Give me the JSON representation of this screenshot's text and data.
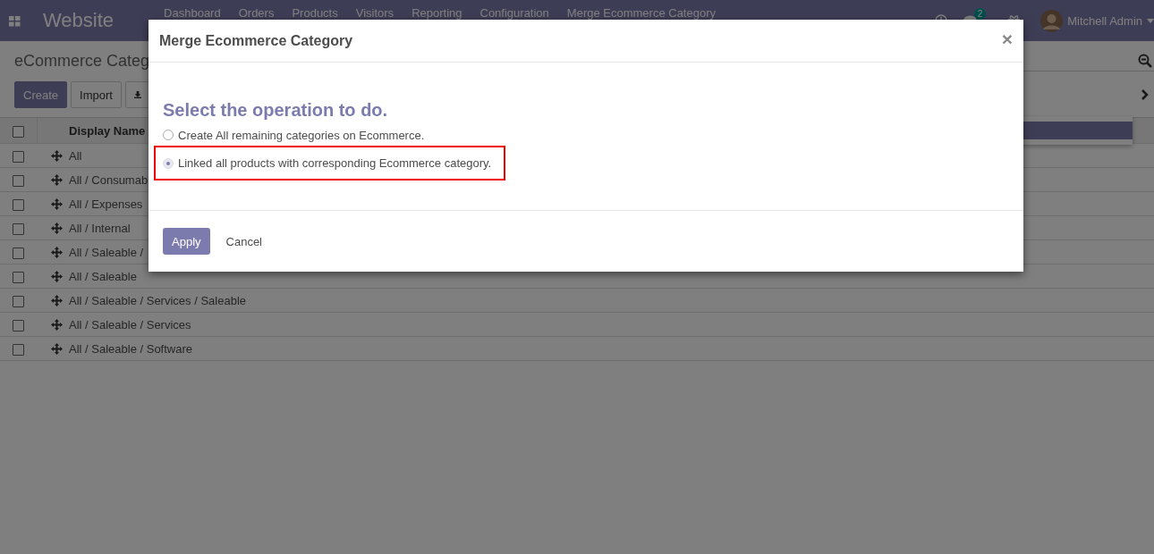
{
  "navbar": {
    "app_title": "Website",
    "menu": [
      "Dashboard",
      "Orders",
      "Products",
      "Visitors",
      "Reporting",
      "Configuration",
      "Merge Ecommerce Category"
    ],
    "chat_badge": "2",
    "user": "Mitchell Admin"
  },
  "page": {
    "title": "eCommerce Categ",
    "buttons": [
      "Create",
      "Import"
    ],
    "table": {
      "header_checked": false,
      "columns": [
        "Display Name"
      ],
      "rows": [
        {
          "name": "All",
          "checked": false
        },
        {
          "name": "All / Consumab",
          "checked": false
        },
        {
          "name": "All / Expenses",
          "checked": false
        },
        {
          "name": "All / Internal",
          "checked": false
        },
        {
          "name": "All / Saleable /",
          "checked": false
        },
        {
          "name": "All / Saleable",
          "checked": false
        },
        {
          "name": "All / Saleable / Services / Saleable",
          "checked": false
        },
        {
          "name": "All / Saleable / Services",
          "checked": false
        },
        {
          "name": "All / Saleable / Software",
          "checked": false
        }
      ]
    }
  },
  "dialog": {
    "title": "Merge Ecommerce Category",
    "close": "×",
    "heading": "Select the operation to do.",
    "options": [
      {
        "label": "Create All remaining categories on Ecommerce.",
        "selected": false,
        "highlighted": false
      },
      {
        "label": "Linked all products with corresponding Ecommerce category.",
        "selected": true,
        "highlighted": true
      }
    ],
    "buttons": [
      {
        "label": "Apply",
        "kind": "primary"
      },
      {
        "label": "Cancel",
        "kind": "link"
      }
    ]
  }
}
